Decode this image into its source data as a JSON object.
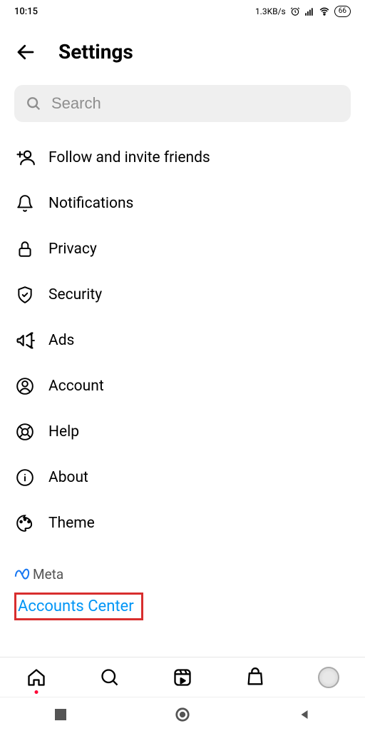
{
  "status": {
    "time": "10:15",
    "speed": "1.3KB/s",
    "battery": "66"
  },
  "header": {
    "title": "Settings"
  },
  "search": {
    "placeholder": "Search"
  },
  "menu": [
    {
      "id": "follow",
      "label": "Follow and invite friends"
    },
    {
      "id": "notifications",
      "label": "Notifications"
    },
    {
      "id": "privacy",
      "label": "Privacy"
    },
    {
      "id": "security",
      "label": "Security"
    },
    {
      "id": "ads",
      "label": "Ads"
    },
    {
      "id": "account",
      "label": "Account"
    },
    {
      "id": "help",
      "label": "Help"
    },
    {
      "id": "about",
      "label": "About"
    },
    {
      "id": "theme",
      "label": "Theme"
    }
  ],
  "meta": {
    "brand": "Meta",
    "link": "Accounts Center"
  }
}
